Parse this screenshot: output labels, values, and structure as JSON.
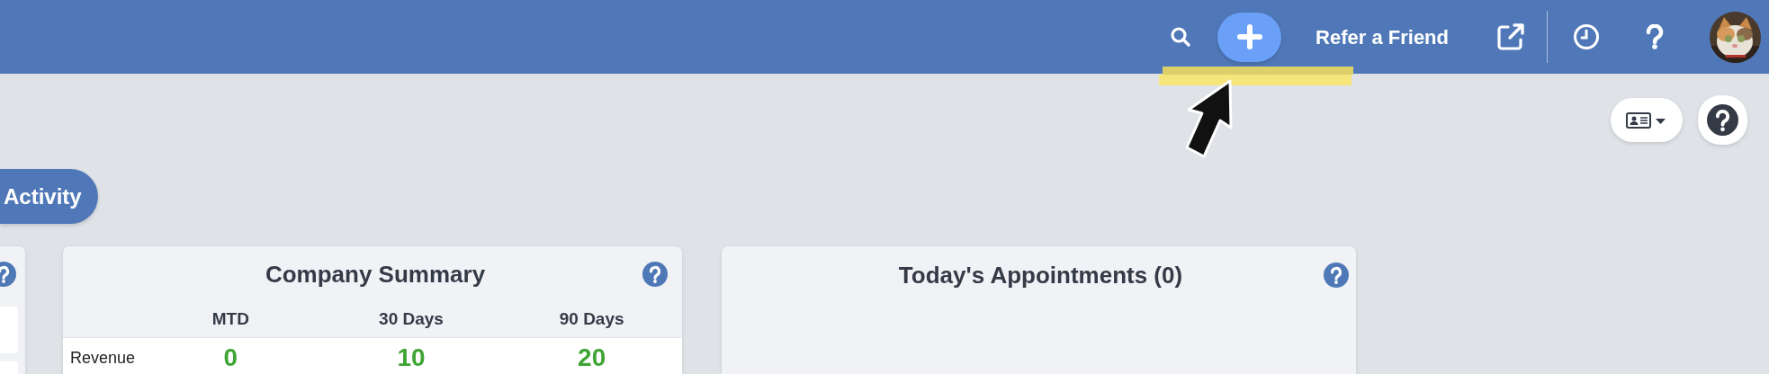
{
  "top_bar": {
    "refer_link": "Refer a Friend"
  },
  "activity_button": "Activity",
  "company_summary": {
    "title": "Company Summary",
    "columns": [
      "MTD",
      "30 Days",
      "90 Days"
    ],
    "rows": [
      {
        "label": "Revenue",
        "values": [
          "0",
          "10",
          "20"
        ]
      }
    ]
  },
  "appointments": {
    "title": "Today's Appointments (0)"
  }
}
